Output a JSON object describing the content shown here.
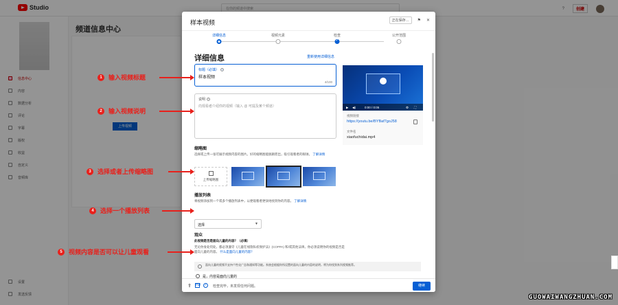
{
  "app": {
    "studio_label": "Studio",
    "search_placeholder": "在你的频道中搜索",
    "create_label": "创建"
  },
  "background": {
    "page_title": "频道信息中心",
    "upload_button": "上传视频",
    "sidebar_items": [
      "信息中心",
      "内容",
      "数据分析",
      "评论",
      "字幕",
      "版权",
      "收益",
      "自定义",
      "音频库"
    ],
    "sidebar_bottom": [
      "设置",
      "发送反馈"
    ]
  },
  "modal": {
    "title": "样本视频",
    "saving_badge": "正在保存…",
    "steps": [
      "详细信息",
      "视频元素",
      "检查",
      "公开范围"
    ],
    "section_title": "详细信息",
    "reuse_link": "重新使用详细信息",
    "title_field": {
      "label": "标题（必填）",
      "value": "样本视频",
      "counter": "4/100"
    },
    "desc_field": {
      "label": "说明",
      "placeholder": "向观看者介绍你的视频（输入 @ 可提及某个频道）"
    },
    "video": {
      "time": "0:00 / 0:05",
      "link_label": "视频链接",
      "link": "https://youtu.be/BYBaf7goJ58",
      "file_label": "文件名",
      "filename": "xiaofuchidai.mp4"
    },
    "thumbnail": {
      "heading": "缩略图",
      "desc": "选择或上传一张可展示视频内容的图片。好的缩略图能脱颖而出，吸引观看者的眼球。",
      "learn_more": "了解详情",
      "upload_label": "上传缩略图"
    },
    "playlist": {
      "heading": "播放列表",
      "desc": "将视频添加到一个或多个播放列表中，以便观看者更快地找到你的内容。",
      "learn_more": "了解详情",
      "select_value": "选择"
    },
    "audience": {
      "heading": "观众",
      "question": "此视频是否是面向儿童的内容？（必填）",
      "desc": "无论你身处何处，都必须遵守《儿童在线隐私权保护法》(COPPA) 和/或其他法律。你必须说明你的视频是否是面向儿童的内容。",
      "learn_more": "什么是面向儿童的内容？",
      "notice": "面向儿童的视频不支持个性化广告和通知等功能。系统会根据你所设置的面向儿童的内容的说明，将为你找到系列视频推荐。",
      "radio_label": "是，内容是面向儿童的"
    },
    "footer": {
      "status": "检查完毕，未发现任何问题。",
      "next": "继续"
    }
  },
  "annotations": [
    {
      "num": "1",
      "text": "输入视频标题"
    },
    {
      "num": "2",
      "text": "输入视频说明"
    },
    {
      "num": "3",
      "text": "选择或者上传缩略图"
    },
    {
      "num": "4",
      "text": "选择一个播放列表"
    },
    {
      "num": "5",
      "text": "视频内容是否可以让儿童观看"
    }
  ],
  "watermark": "GUOWAIWANGZHUAN.COM",
  "colors": {
    "accent": "#065fd4",
    "annotation": "#e8201b",
    "brand": "#ff0000"
  }
}
